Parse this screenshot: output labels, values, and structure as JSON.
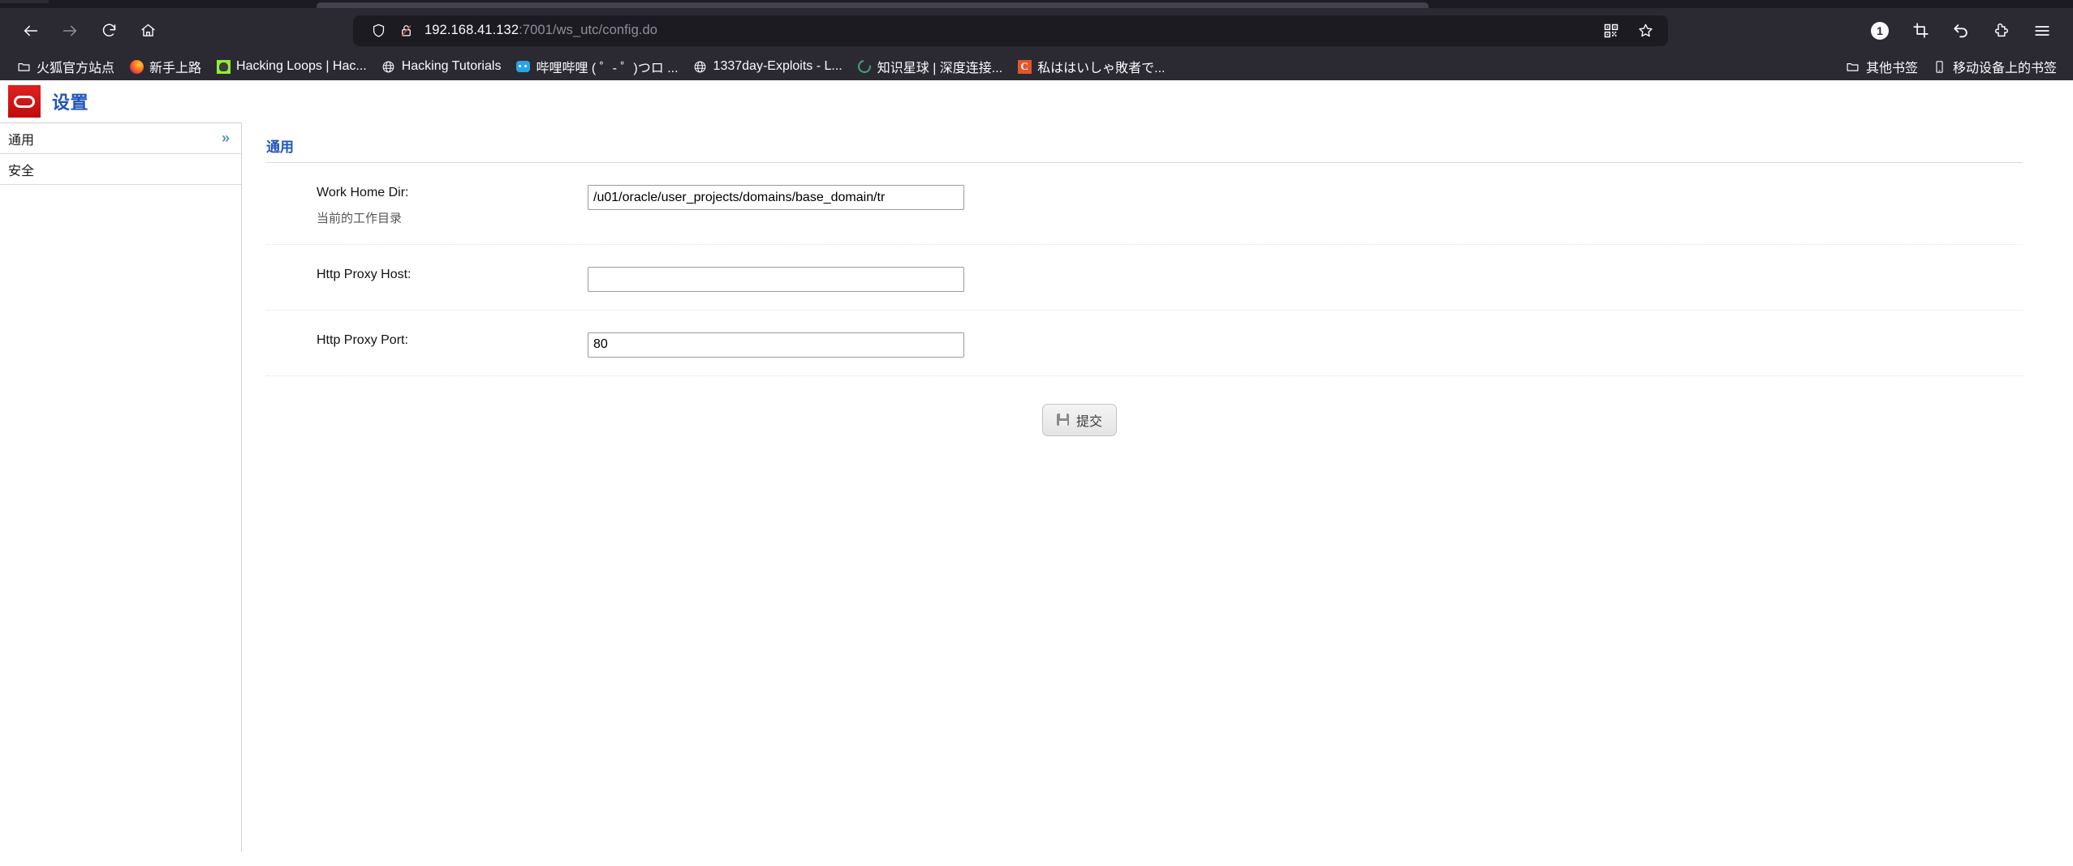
{
  "browser": {
    "nav": {
      "back": "back-arrow",
      "forward": "forward-arrow",
      "reload": "reload",
      "home": "home"
    },
    "urlbar": {
      "shield_icon": "tracking-protection-shield",
      "lock_icon": "insecure-connection-lock",
      "url_host": "192.168.41.132",
      "url_rest": ":7001/ws_utc/config.do",
      "full_url": "192.168.41.132:7001/ws_utc/config.do",
      "qr_icon": "qr-code-icon",
      "bookmark_icon": "star-icon"
    },
    "toolbar_right": {
      "counter_badge": "1",
      "screenshot_icon": "crop-icon",
      "undo_icon": "undo-arrow-icon",
      "extension_icon": "puzzle-piece-icon",
      "menu_icon": "hamburger-menu-icon"
    },
    "bookmarks": [
      {
        "label": "火狐官方站点",
        "favicon": "folder-icon"
      },
      {
        "label": "新手上路",
        "favicon": "firefox-icon"
      },
      {
        "label": "Hacking Loops | Hac...",
        "favicon": "green-skull-icon"
      },
      {
        "label": "Hacking Tutorials",
        "favicon": "globe-icon"
      },
      {
        "label": "哔哩哔哩 ( ゜- ゜)つロ ...",
        "favicon": "bilibili-icon"
      },
      {
        "label": "1337day-Exploits - L...",
        "favicon": "globe-icon"
      },
      {
        "label": "知识星球 | 深度连接...",
        "favicon": "ring-icon"
      },
      {
        "label": "私ははいしゃ敗者で...",
        "favicon": "c-icon"
      }
    ],
    "bookmarks_right": [
      {
        "label": "其他书签",
        "favicon": "folder-icon"
      },
      {
        "label": "移动设备上的书签",
        "favicon": "mobile-icon"
      }
    ]
  },
  "page": {
    "logo": "oracle-logo",
    "title": "设置",
    "sidebar": {
      "items": [
        {
          "label": "通用",
          "chevron": "»"
        },
        {
          "label": "安全",
          "chevron": ""
        }
      ]
    },
    "content": {
      "section_title": "通用",
      "fields": [
        {
          "label": "Work Home Dir:",
          "sublabel": "当前的工作目录",
          "value": "/u01/oracle/user_projects/domains/base_domain/tr",
          "placeholder": ""
        },
        {
          "label": "Http Proxy Host:",
          "sublabel": "",
          "value": "",
          "placeholder": ""
        },
        {
          "label": "Http Proxy Port:",
          "sublabel": "",
          "value": "80",
          "placeholder": ""
        }
      ],
      "submit": {
        "label": "提交",
        "icon": "save-floppy-icon"
      }
    }
  },
  "colors": {
    "chrome_bg": "#2b2a33",
    "urlbar_bg": "#1c1b22",
    "oracle_red": "#c00c0c",
    "link_blue": "#2255bb"
  }
}
